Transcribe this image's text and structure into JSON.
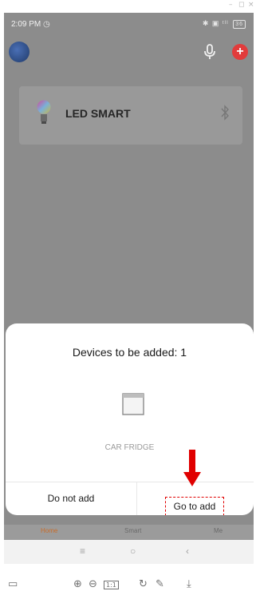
{
  "window": {
    "minimize_glyph": "–",
    "restore_glyph": "◻",
    "close_glyph": "×"
  },
  "status_bar": {
    "time": "2:09 PM",
    "clock_glyph": "◷",
    "indicators": "✱ ▣ ᵗˡˡ",
    "battery": "36"
  },
  "header": {
    "avatar_icon": "avatar",
    "mic_icon": "microphone-icon",
    "add_label": "+"
  },
  "device": {
    "name": "LED SMART",
    "icon": "bulb-icon",
    "connection_icon": "bluetooth-icon"
  },
  "dialog": {
    "title": "Devices to be added: 1",
    "device_label": "CAR FRIDGE",
    "cancel_label": "Do not add",
    "confirm_label": "Go to add"
  },
  "bottom_nav": {
    "home": "Home",
    "smart": "Smart",
    "me": "Me"
  },
  "system_nav": {
    "menu_glyph": "≡",
    "home_glyph": "○",
    "back_glyph": "‹"
  },
  "toolbar": {
    "screen_glyph": "▭",
    "zoom_in_glyph": "⊕",
    "zoom_out_glyph": "⊖",
    "fit_label": "1:1",
    "rotate_glyph": "↻",
    "edit_glyph": "✎",
    "download_glyph": "⤓"
  },
  "colors": {
    "accent_red": "#e23b3b",
    "annotation_red": "#e00000",
    "overlay_gray": "#8c8c8c"
  }
}
